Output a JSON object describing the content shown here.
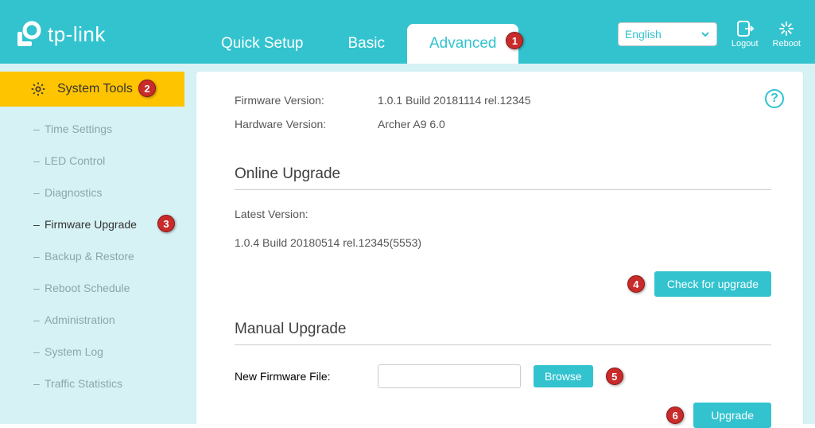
{
  "brand": "tp-link",
  "tabs": {
    "quick_setup": "Quick Setup",
    "basic": "Basic",
    "advanced": "Advanced"
  },
  "language": {
    "selected": "English"
  },
  "header_actions": {
    "logout": "Logout",
    "reboot": "Reboot"
  },
  "sidebar": {
    "category": "System Tools",
    "items": [
      "Time Settings",
      "LED Control",
      "Diagnostics",
      "Firmware Upgrade",
      "Backup & Restore",
      "Reboot Schedule",
      "Administration",
      "System Log",
      "Traffic Statistics"
    ],
    "active_index": 3
  },
  "info": {
    "firmware_label": "Firmware Version:",
    "firmware_value": "1.0.1 Build 20181114 rel.12345",
    "hardware_label": "Hardware Version:",
    "hardware_value": "Archer A9 6.0"
  },
  "online_upgrade": {
    "title": "Online Upgrade",
    "latest_label": "Latest Version:",
    "latest_value": "1.0.4 Build 20180514 rel.12345(5553)",
    "check_button": "Check for upgrade"
  },
  "manual_upgrade": {
    "title": "Manual Upgrade",
    "file_label": "New Firmware File:",
    "file_value": "",
    "browse_button": "Browse",
    "upgrade_button": "Upgrade"
  },
  "annotations": {
    "n1": "1",
    "n2": "2",
    "n3": "3",
    "n4": "4",
    "n5": "5",
    "n6": "6"
  }
}
